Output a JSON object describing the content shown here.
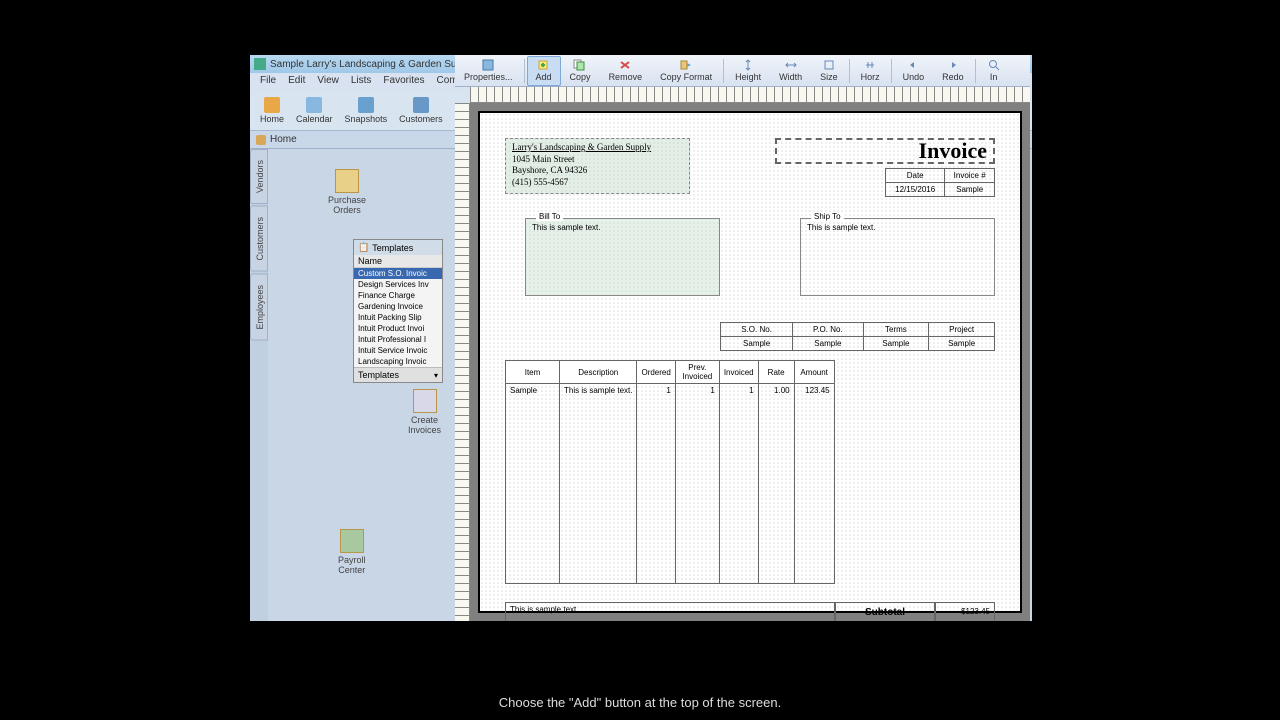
{
  "window": {
    "title": "Sample Larry's Landscaping & Garden Supp"
  },
  "menu": {
    "file": "File",
    "edit": "Edit",
    "view": "View",
    "lists": "Lists",
    "favorites": "Favorites",
    "company": "Compan"
  },
  "sub_toolbar": {
    "home": "Home",
    "calendar": "Calendar",
    "snapshots": "Snapshots",
    "customers": "Customers"
  },
  "home_bar": {
    "label": "Home"
  },
  "side_tabs": {
    "vendors": "Vendors",
    "customers": "Customers",
    "employees": "Employees"
  },
  "shortcuts": {
    "purchase_orders": "Purchase\nOrders",
    "create_invoices": "Create\nInvoices",
    "payroll_center": "Payroll\nCenter"
  },
  "templates": {
    "title": "Templates",
    "col": "Name",
    "items": [
      "Custom S.O. Invoic",
      "Design Services Inv",
      "Finance Charge",
      "Gardening Invoice",
      "Intuit Packing Slip",
      "Intuit Product Invoi",
      "Intuit Professional I",
      "Intuit Service Invoic",
      "Landscaping Invoic"
    ],
    "footer": "Templates"
  },
  "toolbar": {
    "properties": "Properties...",
    "add": "Add",
    "copy": "Copy",
    "remove": "Remove",
    "copy_format": "Copy Format",
    "height": "Height",
    "width": "Width",
    "size": "Size",
    "horz": "Horz",
    "undo": "Undo",
    "redo": "Redo",
    "in": "In"
  },
  "invoice": {
    "company": {
      "name": "Larry's Landscaping & Garden Supply",
      "street": "1045 Main Street",
      "city_state": "Bayshore, CA 94326",
      "phone": "(415) 555-4567"
    },
    "title": "Invoice",
    "date_label": "Date",
    "invoice_num_label": "Invoice #",
    "date_value": "12/15/2016",
    "invoice_num_value": "Sample",
    "bill_to_label": "Bill To",
    "ship_to_label": "Ship To",
    "sample_text": "This is sample text.",
    "order_headers": {
      "so": "S.O. No.",
      "po": "P.O. No.",
      "terms": "Terms",
      "project": "Project"
    },
    "order_values": {
      "so": "Sample",
      "po": "Sample",
      "terms": "Sample",
      "project": "Sample"
    },
    "line_headers": {
      "item": "Item",
      "desc": "Description",
      "ordered": "Ordered",
      "prev": "Prev. Invoiced",
      "invoiced": "Invoiced",
      "rate": "Rate",
      "amount": "Amount"
    },
    "line_row": {
      "item": "Sample",
      "desc": "This is sample text.",
      "ordered": "1",
      "prev": "1",
      "invoiced": "1",
      "rate": "1.00",
      "amount": "123.45"
    },
    "subtotal_label": "Subtotal",
    "subtotal_value": "$123.45"
  },
  "instruction": "Choose the \"Add\" button at the top of the screen."
}
